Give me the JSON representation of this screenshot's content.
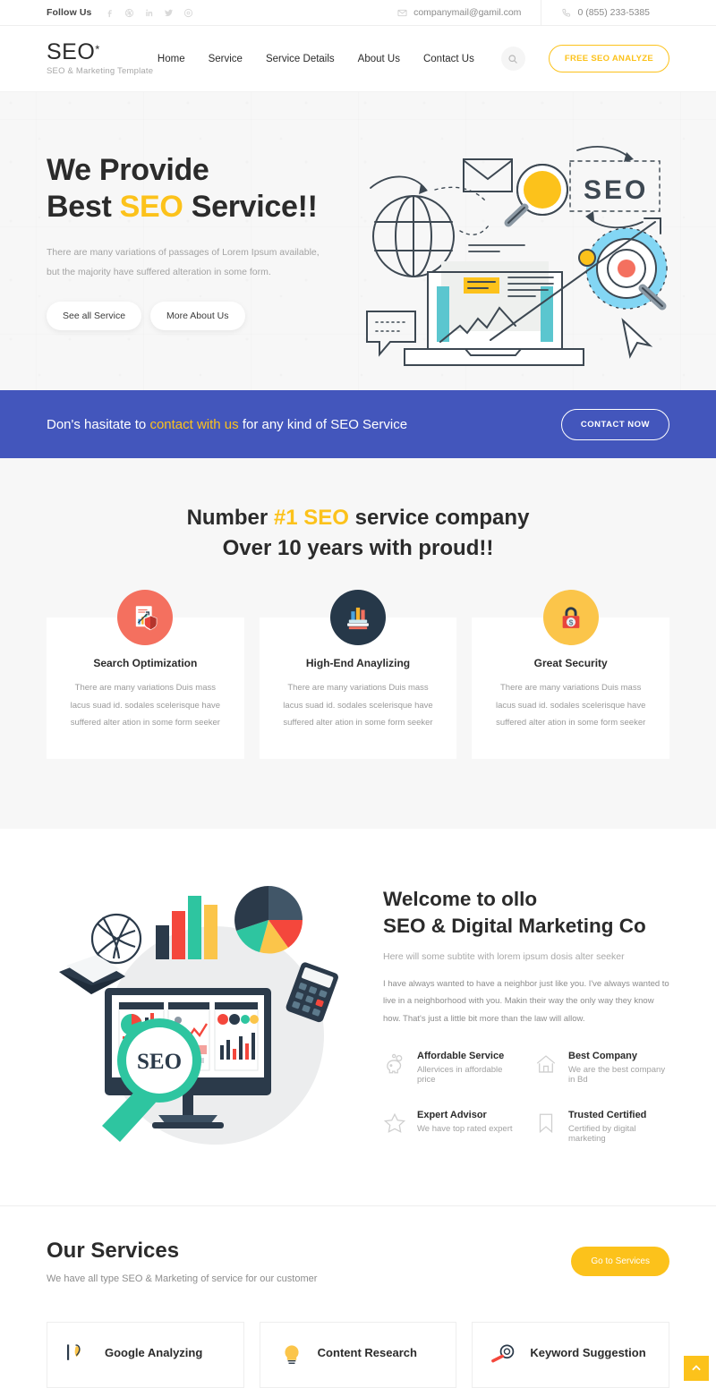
{
  "topbar": {
    "follow_label": "Follow Us",
    "socials": [
      {
        "name": "facebook-icon"
      },
      {
        "name": "dribbble-icon"
      },
      {
        "name": "linkedin-icon"
      },
      {
        "name": "twitter-icon"
      },
      {
        "name": "behance-icon"
      }
    ],
    "email": "companymail@gamil.com",
    "phone": "0 (855) 233-5385"
  },
  "header": {
    "brand_name": "SEO",
    "brand_star": "*",
    "brand_tagline": "SEO & Marketing Template",
    "nav": [
      {
        "label": "Home"
      },
      {
        "label": "Service"
      },
      {
        "label": "Service Details"
      },
      {
        "label": "About Us"
      },
      {
        "label": "Contact Us"
      }
    ],
    "analyze_label": "FREE SEO ANALYZE"
  },
  "hero": {
    "line1": "We Provide",
    "line2_a": "Best ",
    "line2_accent": "SEO",
    "line2_b": " Service!!",
    "sub_line1": "There are many variations of passages of Lorem Ipsum available,",
    "sub_line2": "but the majority have suffered alteration in some form.",
    "btn_primary": "See all Service",
    "btn_secondary": "More About Us",
    "art_label": "SEO"
  },
  "cta": {
    "text_a": "Don's hasitate to ",
    "text_accent": "contact with us",
    "text_b": " for any kind of SEO Service",
    "button": "CONTACT NOW"
  },
  "features": {
    "title_a": "Number ",
    "title_accent": "#1 SEO",
    "title_b": " service company",
    "title_line2": "Over 10 years with proud!!",
    "cards": [
      {
        "icon": "report-shield-icon",
        "icon_bg": "#f4705f",
        "title": "Search Optimization",
        "text": "There are many variations Duis mass lacus suad id. sodales scelerisque have suffered alter ation in some form seeker"
      },
      {
        "icon": "books-chart-icon",
        "icon_bg": "#263849",
        "title": "High-End Anaylizing",
        "text": "There are many variations Duis mass lacus suad id. sodales scelerisque have suffered alter ation in some form seeker"
      },
      {
        "icon": "lock-dollar-icon",
        "icon_bg": "#fbc54a",
        "title": "Great Security",
        "text": "There are many variations Duis mass lacus suad id. sodales scelerisque have suffered alter ation in some form seeker"
      }
    ]
  },
  "welcome": {
    "heading_line1": "Welcome to ollo",
    "heading_line2": "SEO & Digital Marketing Co",
    "subtitle": "Here will some subtite with lorem ipsum dosis alter seeker",
    "paragraph": "I have always wanted to have a neighbor just like you. I've always wanted to live in a neighborhood with you. Makin their way the only way they know how. That's just a little bit more than the law will allow.",
    "art_label": "SEO",
    "perks": [
      {
        "icon": "piggy-bank-icon",
        "title": "Affordable Service",
        "sub": "Allervices in affordable price"
      },
      {
        "icon": "home-icon",
        "title": "Best Company",
        "sub": "We are the best company in Bd"
      },
      {
        "icon": "star-icon",
        "title": "Expert Advisor",
        "sub": "We have top rated expert"
      },
      {
        "icon": "bookmark-icon",
        "title": "Trusted Certified",
        "sub": "Certified by digital marketing"
      }
    ]
  },
  "services": {
    "heading": "Our Services",
    "subtitle": "We have all type SEO & Marketing of service for our customer",
    "button": "Go to Services",
    "cards": [
      {
        "icon": "google-analytics-icon",
        "title": "Google Analyzing"
      },
      {
        "icon": "content-bulb-icon",
        "title": "Content Research"
      },
      {
        "icon": "keyword-magnifier-icon",
        "title": "Keyword Suggestion"
      }
    ]
  },
  "scroll_top": {
    "name": "scroll-to-top"
  },
  "colors": {
    "accent_yellow": "#fcc21b",
    "banner_blue": "#4356bc",
    "dark_text": "#2b2b2b",
    "muted_text": "#9a9a9a",
    "page_bg": "#f7f7f7"
  }
}
